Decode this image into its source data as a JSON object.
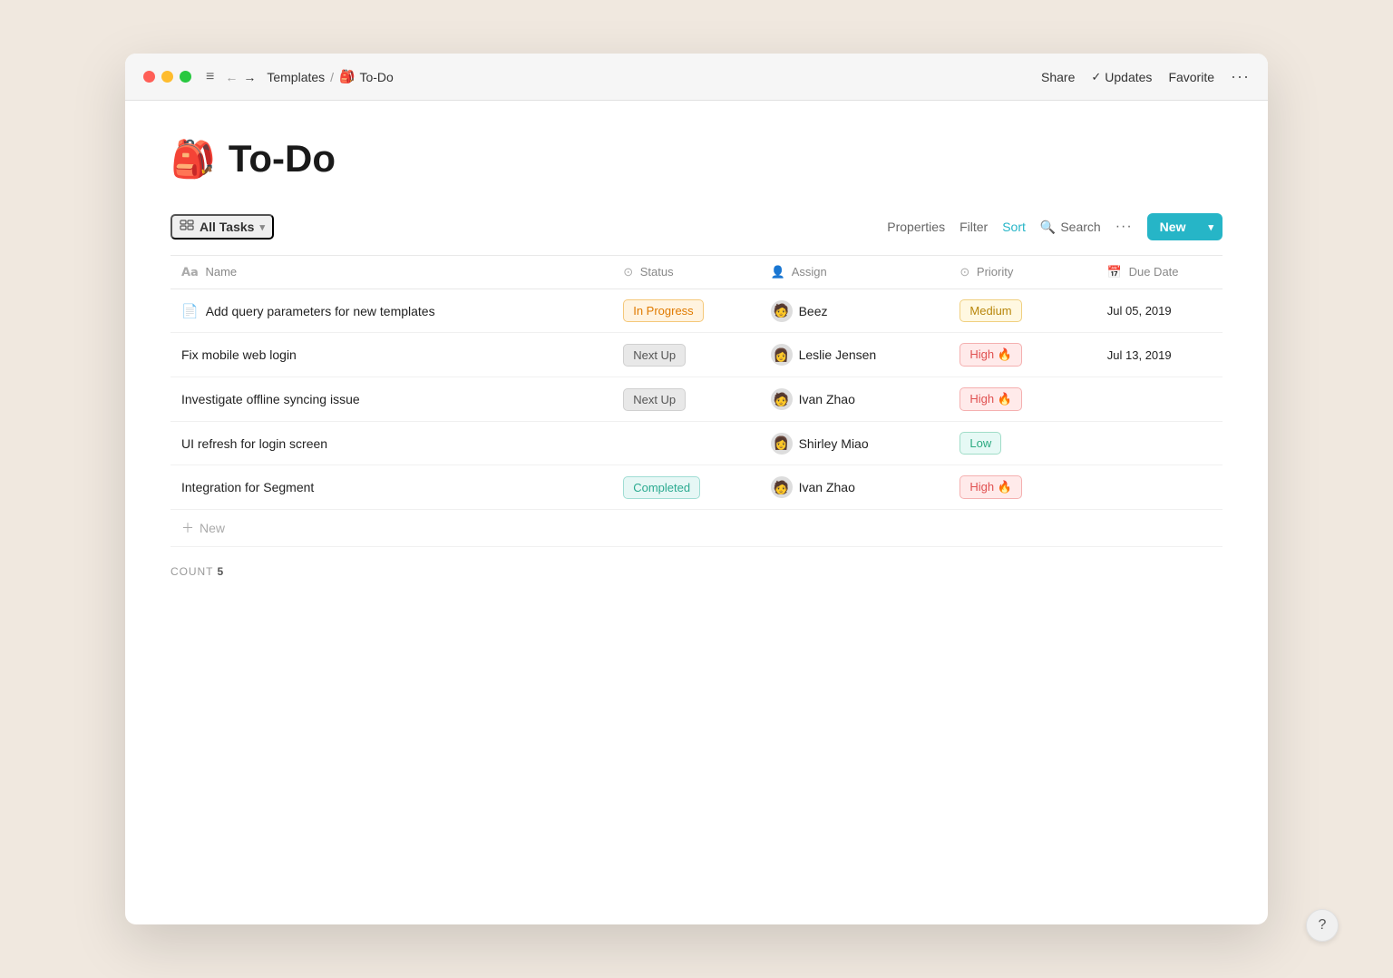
{
  "window": {
    "titlebar": {
      "breadcrumb_templates": "Templates",
      "breadcrumb_separator": "/",
      "breadcrumb_current": "To-Do",
      "breadcrumb_icon": "🎒",
      "share_label": "Share",
      "updates_label": "Updates",
      "favorite_label": "Favorite",
      "more_label": "···"
    }
  },
  "page": {
    "icon": "🎒",
    "title": "To-Do"
  },
  "toolbar": {
    "all_tasks_label": "All Tasks",
    "properties_label": "Properties",
    "filter_label": "Filter",
    "sort_label": "Sort",
    "search_label": "Search",
    "more_label": "···",
    "new_label": "New"
  },
  "table": {
    "columns": [
      {
        "id": "name",
        "label": "Name",
        "icon": "name-icon"
      },
      {
        "id": "status",
        "label": "Status",
        "icon": "status-icon"
      },
      {
        "id": "assign",
        "label": "Assign",
        "icon": "assign-icon"
      },
      {
        "id": "priority",
        "label": "Priority",
        "icon": "priority-icon"
      },
      {
        "id": "duedate",
        "label": "Due Date",
        "icon": "duedate-icon"
      }
    ],
    "rows": [
      {
        "id": 1,
        "name": "Add query parameters for new templates",
        "has_doc_icon": true,
        "status": "In Progress",
        "status_type": "in-progress",
        "assignee": "Beez",
        "assignee_avatar": "🧑",
        "priority": "Medium",
        "priority_type": "medium",
        "priority_emoji": "",
        "due_date": "Jul 05, 2019"
      },
      {
        "id": 2,
        "name": "Fix mobile web login",
        "has_doc_icon": false,
        "status": "Next Up",
        "status_type": "next-up",
        "assignee": "Leslie Jensen",
        "assignee_avatar": "👩",
        "priority": "High 🔥",
        "priority_type": "high",
        "priority_emoji": "🔥",
        "due_date": "Jul 13, 2019"
      },
      {
        "id": 3,
        "name": "Investigate offline syncing issue",
        "has_doc_icon": false,
        "status": "Next Up",
        "status_type": "next-up",
        "assignee": "Ivan Zhao",
        "assignee_avatar": "🧑",
        "priority": "High 🔥",
        "priority_type": "high",
        "priority_emoji": "🔥",
        "due_date": ""
      },
      {
        "id": 4,
        "name": "UI refresh for login screen",
        "has_doc_icon": false,
        "status": "",
        "status_type": "",
        "assignee": "Shirley Miao",
        "assignee_avatar": "👩",
        "priority": "Low",
        "priority_type": "low",
        "priority_emoji": "",
        "due_date": ""
      },
      {
        "id": 5,
        "name": "Integration for Segment",
        "has_doc_icon": false,
        "status": "Completed",
        "status_type": "completed",
        "assignee": "Ivan Zhao",
        "assignee_avatar": "🧑",
        "priority": "High 🔥",
        "priority_type": "high",
        "priority_emoji": "🔥",
        "due_date": ""
      }
    ],
    "add_new_label": "New",
    "count_label": "COUNT",
    "count_value": "5"
  },
  "help_button_label": "?"
}
